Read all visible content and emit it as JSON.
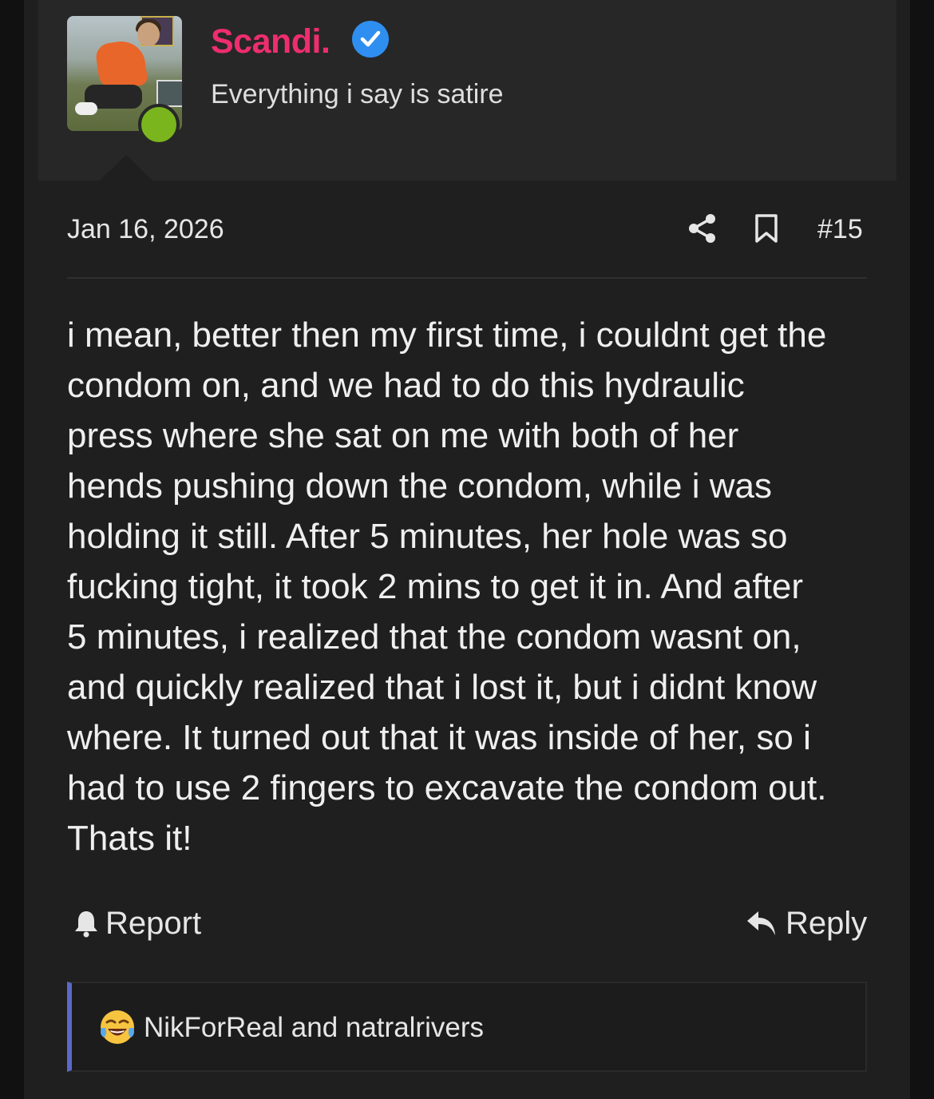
{
  "colors": {
    "page_background": "#111111",
    "post_background": "#1f1f1f",
    "user_block_background": "#272727",
    "username": "#ee2d6f",
    "verified_badge": "#2f8ff1",
    "online_indicator": "#7ab51d",
    "reaction_bar_accent": "#5b68c8"
  },
  "author": {
    "name": "Scandi.",
    "verified": true,
    "title": "Everything i say is satire",
    "online": true,
    "avatar_icon": "avatar-image"
  },
  "post": {
    "date": "Jan 16, 2026",
    "number": "#15",
    "share_icon": "share-icon",
    "bookmark_icon": "bookmark-icon",
    "body_lines": [
      "i mean, better then my first time, i couldnt get the",
      "condom on, and we had to do this hydraulic",
      "press where she sat on me with both of her",
      "hends pushing down the condom, while i was",
      "holding it still. After 5 minutes, her hole was so",
      "fucking tight, it took 2 mins to get it in. And after",
      "5 minutes, i realized that the condom wasnt on,",
      "and quickly realized that i lost it, but i didnt know",
      "where. It turned out that it was inside of her, so i",
      "had to use 2 fingers to excavate the condom out.",
      "Thats it!"
    ]
  },
  "actions": {
    "report_label": "Report",
    "report_icon": "bell-icon",
    "reply_label": "Reply",
    "reply_icon": "reply-arrow-icon"
  },
  "reactions": {
    "emoji": "laughing-crying-emoji",
    "names": "NikForReal and natralrivers"
  }
}
